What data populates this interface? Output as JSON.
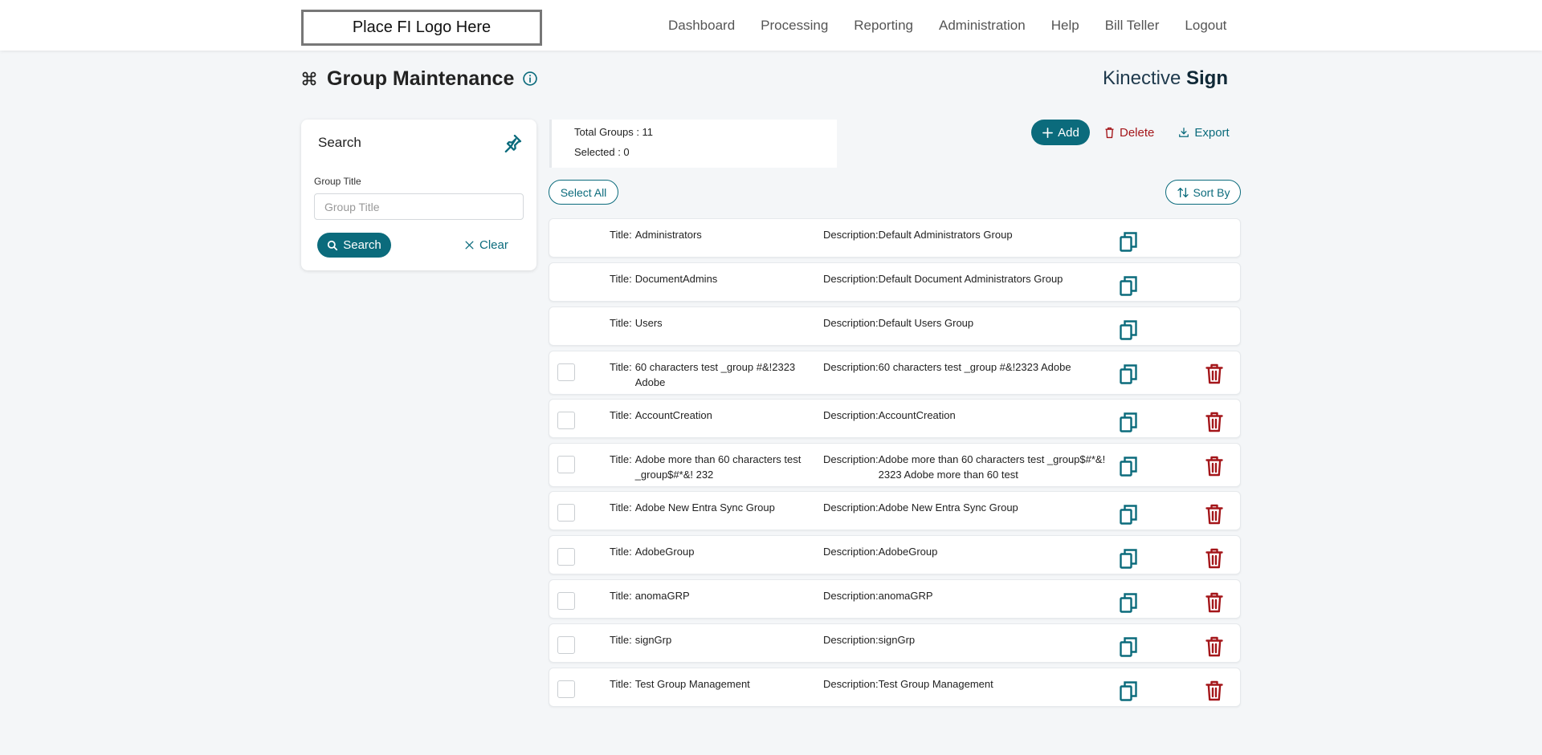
{
  "header": {
    "logo_text": "Place FI Logo Here",
    "nav": [
      "Dashboard",
      "Processing",
      "Reporting",
      "Administration",
      "Help",
      "Bill Teller",
      "Logout"
    ]
  },
  "page": {
    "title": "Group Maintenance",
    "brand_light": "Kinective ",
    "brand_bold": "Sign"
  },
  "search": {
    "heading": "Search",
    "field_label": "Group Title",
    "field_value": "",
    "field_placeholder": "Group Title",
    "search_label": "Search",
    "clear_label": "Clear"
  },
  "summary": {
    "total": "Total Groups : 11",
    "selected": "Selected : 0"
  },
  "actions": {
    "add": "Add",
    "delete": "Delete",
    "export": "Export",
    "select_all": "Select All",
    "sort_by": "Sort By"
  },
  "labels": {
    "title": "Title:",
    "description": "Description:"
  },
  "groups": [
    {
      "title": "Administrators",
      "description": "Default Administrators Group",
      "system": true
    },
    {
      "title": "DocumentAdmins",
      "description": "Default Document Administrators Group",
      "system": true
    },
    {
      "title": "Users",
      "description": "Default Users Group",
      "system": true
    },
    {
      "title": "60 characters test _group #&!2323 Adobe",
      "description": "60 characters test _group #&!2323 Adobe",
      "system": false
    },
    {
      "title": "AccountCreation",
      "description": "AccountCreation",
      "system": false
    },
    {
      "title": "Adobe more than 60 characters test _group$#*&! 232",
      "description": "Adobe more than 60 characters test _group$#*&! 2323 Adobe more than 60 test",
      "system": false
    },
    {
      "title": "Adobe New Entra Sync Group",
      "description": "Adobe New Entra Sync Group",
      "system": false
    },
    {
      "title": "AdobeGroup",
      "description": "AdobeGroup",
      "system": false
    },
    {
      "title": "anomaGRP",
      "description": "anomaGRP",
      "system": false
    },
    {
      "title": "signGrp",
      "description": "signGrp",
      "system": false
    },
    {
      "title": "Test Group Management",
      "description": "Test Group Management",
      "system": false
    }
  ],
  "colors": {
    "accent": "#0b6b7c",
    "danger": "#a4161a",
    "background": "#f4f6f8"
  }
}
